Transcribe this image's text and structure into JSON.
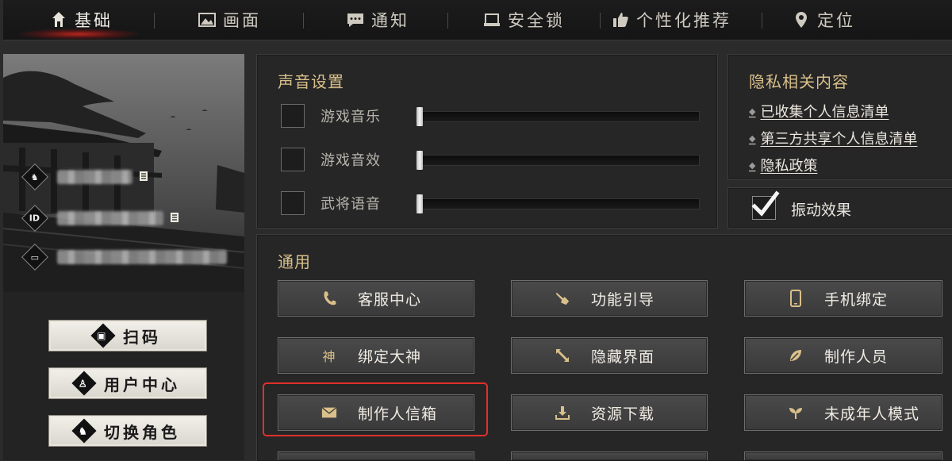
{
  "tabs": [
    {
      "label": "基础",
      "icon": "home-icon",
      "active": true
    },
    {
      "label": "画面",
      "icon": "picture-icon"
    },
    {
      "label": "通知",
      "icon": "chat-icon"
    },
    {
      "label": "安全锁",
      "icon": "lock-icon"
    },
    {
      "label": "个性化推荐",
      "icon": "thumbs-up-icon"
    },
    {
      "label": "定位",
      "icon": "location-pin-icon"
    }
  ],
  "profile": {
    "id_badge": "ID",
    "buttons": [
      {
        "label": "扫码",
        "icon": "scan-icon"
      },
      {
        "label": "用户中心",
        "icon": "user-icon"
      },
      {
        "label": "切换角色",
        "icon": "switch-role-icon"
      }
    ]
  },
  "sound": {
    "title": "声音设置",
    "rows": [
      {
        "label": "游戏音乐",
        "checked": false,
        "level": 0
      },
      {
        "label": "游戏音效",
        "checked": false,
        "level": 0
      },
      {
        "label": "武将语音",
        "checked": false,
        "level": 0
      }
    ]
  },
  "privacy": {
    "title": "隐私相关内容",
    "links": [
      "已收集个人信息清单",
      "第三方共享个人信息清单",
      "隐私政策"
    ]
  },
  "vibration": {
    "label": "振动效果",
    "checked": true
  },
  "general": {
    "title": "通用",
    "buttons": [
      {
        "label": "客服中心",
        "icon": "phone-icon"
      },
      {
        "label": "功能引导",
        "icon": "pointing-hand-icon"
      },
      {
        "label": "手机绑定",
        "icon": "mobile-phone-icon"
      },
      {
        "label": "绑定大神",
        "icon": "god-char-icon",
        "glyph": "神"
      },
      {
        "label": "隐藏界面",
        "icon": "expand-arrows-icon"
      },
      {
        "label": "制作人员",
        "icon": "leaf-icon"
      },
      {
        "label": "制作人信箱",
        "icon": "envelope-icon",
        "highlighted": true
      },
      {
        "label": "资源下载",
        "icon": "download-icon"
      },
      {
        "label": "未成年人模式",
        "icon": "sprout-icon"
      }
    ]
  },
  "colors": {
    "accent_gold": "#d9c08a",
    "highlight_red": "#e0302a",
    "tab_glow": "#d2281e"
  }
}
